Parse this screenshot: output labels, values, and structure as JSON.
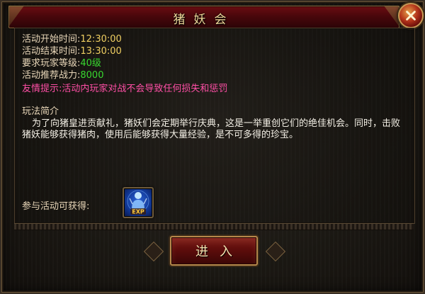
{
  "dialog": {
    "title": "猪妖会",
    "close_icon": "close-x-icon"
  },
  "info": {
    "start_label": "活动开始时间:",
    "start_value": "12:30:00",
    "end_label": "活动结束时间:",
    "end_value": "13:30:00",
    "level_label": "要求玩家等级:",
    "level_value": "40级",
    "power_label": "活动推荐战力:",
    "power_value": "8000",
    "tip": "友情提示:活动内玩家对战不会导致任何损失和惩罚"
  },
  "intro": {
    "heading": "玩法简介",
    "text": "为了向猪皇进贡献礼，猪妖们会定期举行庆典，这是一举重创它们的绝佳机会。同时，击败猪妖能够获得猪肉，使用后能够获得大量经验，是不可多得的珍宝。"
  },
  "reward": {
    "label": "参与活动可获得:",
    "icon_text": "EXP",
    "icon": "exp-reward-icon"
  },
  "actions": {
    "enter_label": "进入"
  },
  "colors": {
    "value_yellow": "#f0cf62",
    "value_green": "#38d82f",
    "tip_pink": "#ff4fa6",
    "title_red": "#5a0a0e"
  }
}
